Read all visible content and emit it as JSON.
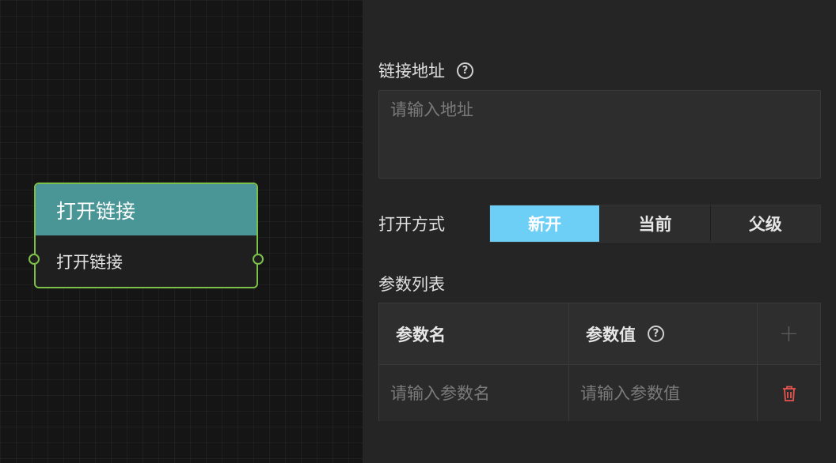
{
  "canvas": {
    "node": {
      "title": "打开链接",
      "body": "打开链接"
    }
  },
  "panel": {
    "url_label": "链接地址",
    "url_placeholder": "请输入地址",
    "open_mode_label": "打开方式",
    "open_modes": [
      {
        "label": "新开",
        "active": true
      },
      {
        "label": "当前",
        "active": false
      },
      {
        "label": "父级",
        "active": false
      }
    ],
    "params_label": "参数列表",
    "params_table": {
      "headers": [
        "参数名",
        "参数值"
      ],
      "row_placeholders": {
        "name": "请输入参数名",
        "value": "请输入参数值"
      }
    }
  },
  "colors": {
    "node_border": "#7cc04a",
    "node_header": "#4a9696",
    "active_segment": "#6dcff6",
    "delete_icon": "#e8544e"
  },
  "icons": {
    "help": "help-circle-icon",
    "add": "plus-icon",
    "delete": "trash-icon"
  }
}
